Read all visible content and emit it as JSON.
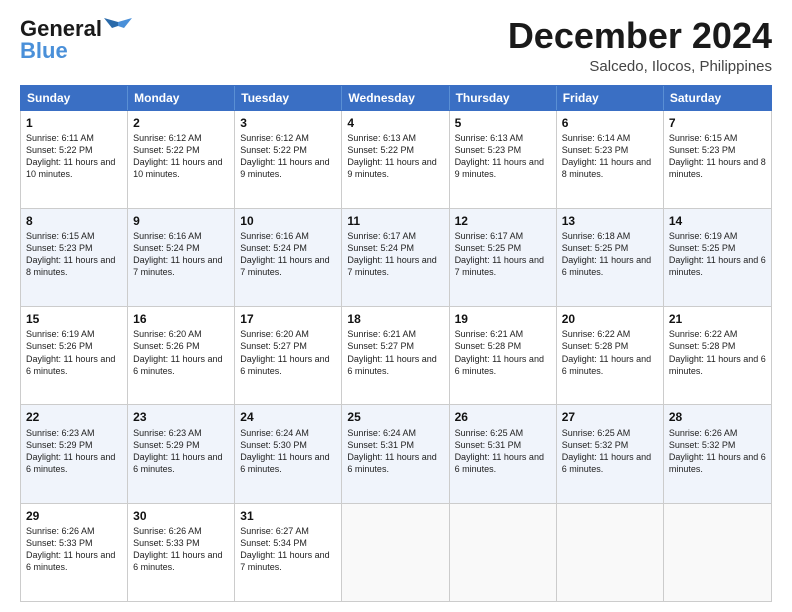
{
  "logo": {
    "line1": "General",
    "line2": "Blue"
  },
  "title": {
    "month": "December 2024",
    "location": "Salcedo, Ilocos, Philippines"
  },
  "calendar": {
    "headers": [
      "Sunday",
      "Monday",
      "Tuesday",
      "Wednesday",
      "Thursday",
      "Friday",
      "Saturday"
    ],
    "rows": [
      [
        {
          "day": "1",
          "sunrise": "Sunrise: 6:11 AM",
          "sunset": "Sunset: 5:22 PM",
          "daylight": "Daylight: 11 hours and 10 minutes."
        },
        {
          "day": "2",
          "sunrise": "Sunrise: 6:12 AM",
          "sunset": "Sunset: 5:22 PM",
          "daylight": "Daylight: 11 hours and 10 minutes."
        },
        {
          "day": "3",
          "sunrise": "Sunrise: 6:12 AM",
          "sunset": "Sunset: 5:22 PM",
          "daylight": "Daylight: 11 hours and 9 minutes."
        },
        {
          "day": "4",
          "sunrise": "Sunrise: 6:13 AM",
          "sunset": "Sunset: 5:22 PM",
          "daylight": "Daylight: 11 hours and 9 minutes."
        },
        {
          "day": "5",
          "sunrise": "Sunrise: 6:13 AM",
          "sunset": "Sunset: 5:23 PM",
          "daylight": "Daylight: 11 hours and 9 minutes."
        },
        {
          "day": "6",
          "sunrise": "Sunrise: 6:14 AM",
          "sunset": "Sunset: 5:23 PM",
          "daylight": "Daylight: 11 hours and 8 minutes."
        },
        {
          "day": "7",
          "sunrise": "Sunrise: 6:15 AM",
          "sunset": "Sunset: 5:23 PM",
          "daylight": "Daylight: 11 hours and 8 minutes."
        }
      ],
      [
        {
          "day": "8",
          "sunrise": "Sunrise: 6:15 AM",
          "sunset": "Sunset: 5:23 PM",
          "daylight": "Daylight: 11 hours and 8 minutes."
        },
        {
          "day": "9",
          "sunrise": "Sunrise: 6:16 AM",
          "sunset": "Sunset: 5:24 PM",
          "daylight": "Daylight: 11 hours and 7 minutes."
        },
        {
          "day": "10",
          "sunrise": "Sunrise: 6:16 AM",
          "sunset": "Sunset: 5:24 PM",
          "daylight": "Daylight: 11 hours and 7 minutes."
        },
        {
          "day": "11",
          "sunrise": "Sunrise: 6:17 AM",
          "sunset": "Sunset: 5:24 PM",
          "daylight": "Daylight: 11 hours and 7 minutes."
        },
        {
          "day": "12",
          "sunrise": "Sunrise: 6:17 AM",
          "sunset": "Sunset: 5:25 PM",
          "daylight": "Daylight: 11 hours and 7 minutes."
        },
        {
          "day": "13",
          "sunrise": "Sunrise: 6:18 AM",
          "sunset": "Sunset: 5:25 PM",
          "daylight": "Daylight: 11 hours and 6 minutes."
        },
        {
          "day": "14",
          "sunrise": "Sunrise: 6:19 AM",
          "sunset": "Sunset: 5:25 PM",
          "daylight": "Daylight: 11 hours and 6 minutes."
        }
      ],
      [
        {
          "day": "15",
          "sunrise": "Sunrise: 6:19 AM",
          "sunset": "Sunset: 5:26 PM",
          "daylight": "Daylight: 11 hours and 6 minutes."
        },
        {
          "day": "16",
          "sunrise": "Sunrise: 6:20 AM",
          "sunset": "Sunset: 5:26 PM",
          "daylight": "Daylight: 11 hours and 6 minutes."
        },
        {
          "day": "17",
          "sunrise": "Sunrise: 6:20 AM",
          "sunset": "Sunset: 5:27 PM",
          "daylight": "Daylight: 11 hours and 6 minutes."
        },
        {
          "day": "18",
          "sunrise": "Sunrise: 6:21 AM",
          "sunset": "Sunset: 5:27 PM",
          "daylight": "Daylight: 11 hours and 6 minutes."
        },
        {
          "day": "19",
          "sunrise": "Sunrise: 6:21 AM",
          "sunset": "Sunset: 5:28 PM",
          "daylight": "Daylight: 11 hours and 6 minutes."
        },
        {
          "day": "20",
          "sunrise": "Sunrise: 6:22 AM",
          "sunset": "Sunset: 5:28 PM",
          "daylight": "Daylight: 11 hours and 6 minutes."
        },
        {
          "day": "21",
          "sunrise": "Sunrise: 6:22 AM",
          "sunset": "Sunset: 5:28 PM",
          "daylight": "Daylight: 11 hours and 6 minutes."
        }
      ],
      [
        {
          "day": "22",
          "sunrise": "Sunrise: 6:23 AM",
          "sunset": "Sunset: 5:29 PM",
          "daylight": "Daylight: 11 hours and 6 minutes."
        },
        {
          "day": "23",
          "sunrise": "Sunrise: 6:23 AM",
          "sunset": "Sunset: 5:29 PM",
          "daylight": "Daylight: 11 hours and 6 minutes."
        },
        {
          "day": "24",
          "sunrise": "Sunrise: 6:24 AM",
          "sunset": "Sunset: 5:30 PM",
          "daylight": "Daylight: 11 hours and 6 minutes."
        },
        {
          "day": "25",
          "sunrise": "Sunrise: 6:24 AM",
          "sunset": "Sunset: 5:31 PM",
          "daylight": "Daylight: 11 hours and 6 minutes."
        },
        {
          "day": "26",
          "sunrise": "Sunrise: 6:25 AM",
          "sunset": "Sunset: 5:31 PM",
          "daylight": "Daylight: 11 hours and 6 minutes."
        },
        {
          "day": "27",
          "sunrise": "Sunrise: 6:25 AM",
          "sunset": "Sunset: 5:32 PM",
          "daylight": "Daylight: 11 hours and 6 minutes."
        },
        {
          "day": "28",
          "sunrise": "Sunrise: 6:26 AM",
          "sunset": "Sunset: 5:32 PM",
          "daylight": "Daylight: 11 hours and 6 minutes."
        }
      ],
      [
        {
          "day": "29",
          "sunrise": "Sunrise: 6:26 AM",
          "sunset": "Sunset: 5:33 PM",
          "daylight": "Daylight: 11 hours and 6 minutes."
        },
        {
          "day": "30",
          "sunrise": "Sunrise: 6:26 AM",
          "sunset": "Sunset: 5:33 PM",
          "daylight": "Daylight: 11 hours and 6 minutes."
        },
        {
          "day": "31",
          "sunrise": "Sunrise: 6:27 AM",
          "sunset": "Sunset: 5:34 PM",
          "daylight": "Daylight: 11 hours and 7 minutes."
        },
        {
          "day": "",
          "sunrise": "",
          "sunset": "",
          "daylight": ""
        },
        {
          "day": "",
          "sunrise": "",
          "sunset": "",
          "daylight": ""
        },
        {
          "day": "",
          "sunrise": "",
          "sunset": "",
          "daylight": ""
        },
        {
          "day": "",
          "sunrise": "",
          "sunset": "",
          "daylight": ""
        }
      ]
    ]
  }
}
